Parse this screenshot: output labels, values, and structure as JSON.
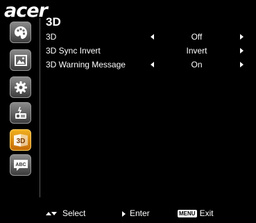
{
  "brand": "acer",
  "sidebar": {
    "items": [
      {
        "icon": "palette-icon",
        "active": false
      },
      {
        "icon": "image-icon",
        "active": false
      },
      {
        "icon": "gear-icon",
        "active": false
      },
      {
        "icon": "projector-icon",
        "active": false
      },
      {
        "icon": "3d-icon",
        "label": "3D",
        "active": true
      },
      {
        "icon": "language-icon",
        "label": "ABC",
        "active": false
      }
    ]
  },
  "panel": {
    "title": "3D",
    "rows": [
      {
        "label": "3D",
        "value": "Off",
        "left_arrow": true,
        "right_arrow": true
      },
      {
        "label": "3D Sync Invert",
        "value": "Invert",
        "left_arrow": false,
        "right_arrow": true
      },
      {
        "label": "3D Warning Message",
        "value": "On",
        "left_arrow": true,
        "right_arrow": true
      }
    ]
  },
  "footer": {
    "select_label": "Select",
    "enter_label": "Enter",
    "menu_key": "MENU",
    "exit_label": "Exit"
  },
  "colors": {
    "background": "#000000",
    "active_icon": "#e08a10",
    "inactive_icon": "#5a5a5a"
  }
}
